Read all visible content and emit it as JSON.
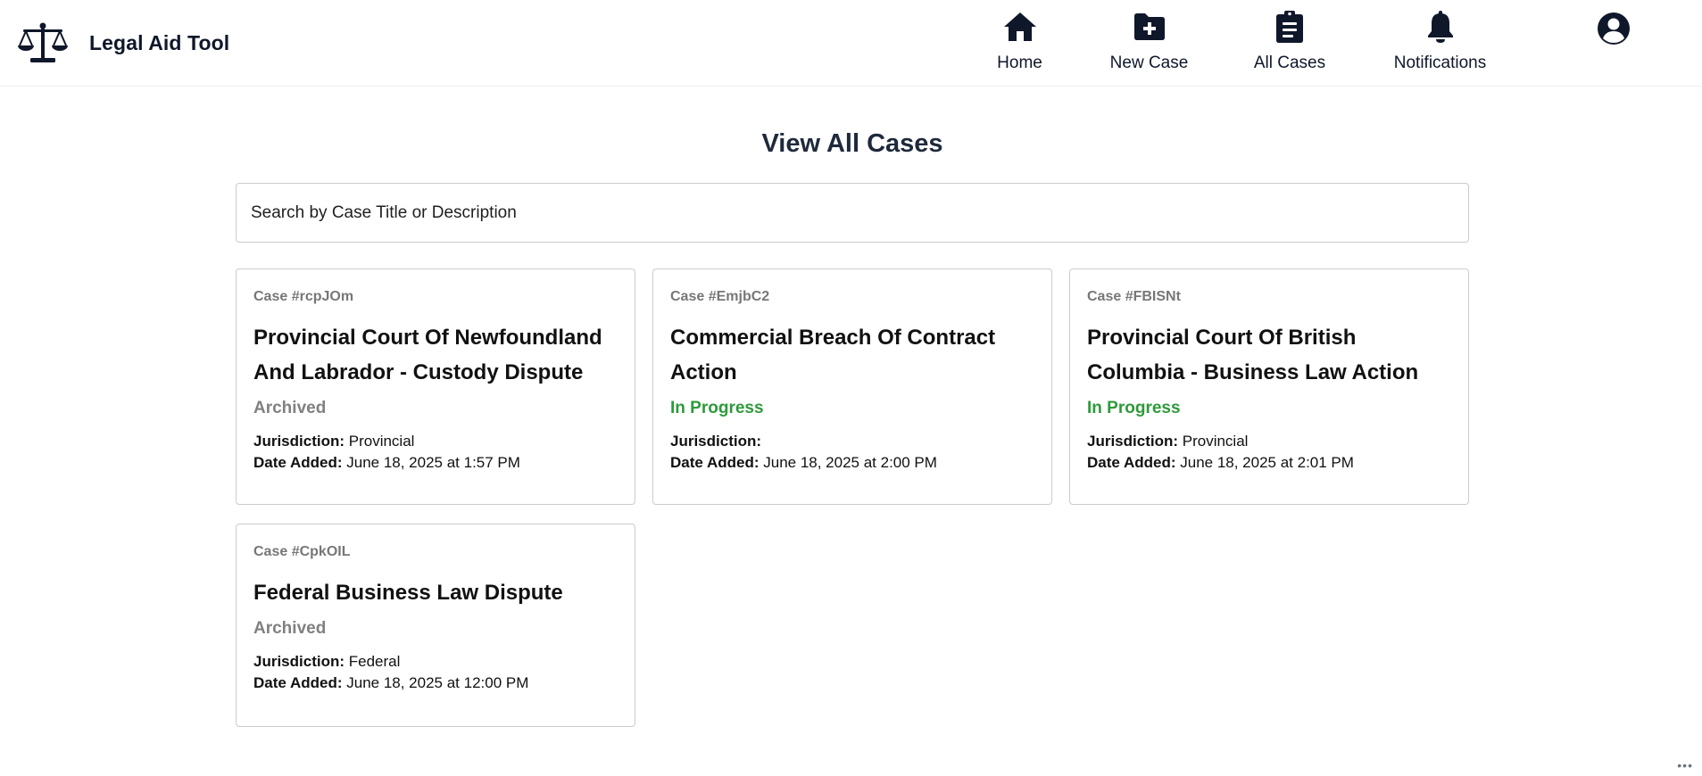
{
  "app": {
    "name": "Legal Aid Tool",
    "logo_icon": "scales-icon"
  },
  "nav": {
    "items": [
      {
        "label": "Home",
        "icon": "home-icon"
      },
      {
        "label": "New Case",
        "icon": "folder-plus-icon"
      },
      {
        "label": "All Cases",
        "icon": "clipboard-list-icon"
      },
      {
        "label": "Notifications",
        "icon": "bell-icon"
      }
    ],
    "profile_icon": "user-circle-icon"
  },
  "page": {
    "title": "View All Cases"
  },
  "search": {
    "placeholder": "Search by Case Title or Description",
    "value": ""
  },
  "labels": {
    "jurisdiction": "Jurisdiction:",
    "date_added": "Date Added:"
  },
  "colors": {
    "status_archived": "#808080",
    "status_in_progress": "#2e9a3a",
    "brand_dark": "#0f172a"
  },
  "cases": [
    {
      "id": "Case #rcpJOm",
      "title": "Provincial Court Of Newfoundland And Labrador - Custody Dispute",
      "status": "Archived",
      "jurisdiction": "Provincial",
      "date_added": "June 18, 2025 at 1:57 PM"
    },
    {
      "id": "Case #EmjbC2",
      "title": "Commercial Breach Of Contract Action",
      "status": "In Progress",
      "jurisdiction": "",
      "date_added": "June 18, 2025 at 2:00 PM"
    },
    {
      "id": "Case #FBISNt",
      "title": "Provincial Court Of British Columbia - Business Law Action",
      "status": "In Progress",
      "jurisdiction": "Provincial",
      "date_added": "June 18, 2025 at 2:01 PM"
    },
    {
      "id": "Case #CpkOIL",
      "title": "Federal Business Law Dispute",
      "status": "Archived",
      "jurisdiction": "Federal",
      "date_added": "June 18, 2025 at 12:00 PM"
    }
  ],
  "footer": {
    "more_text": "•••"
  }
}
